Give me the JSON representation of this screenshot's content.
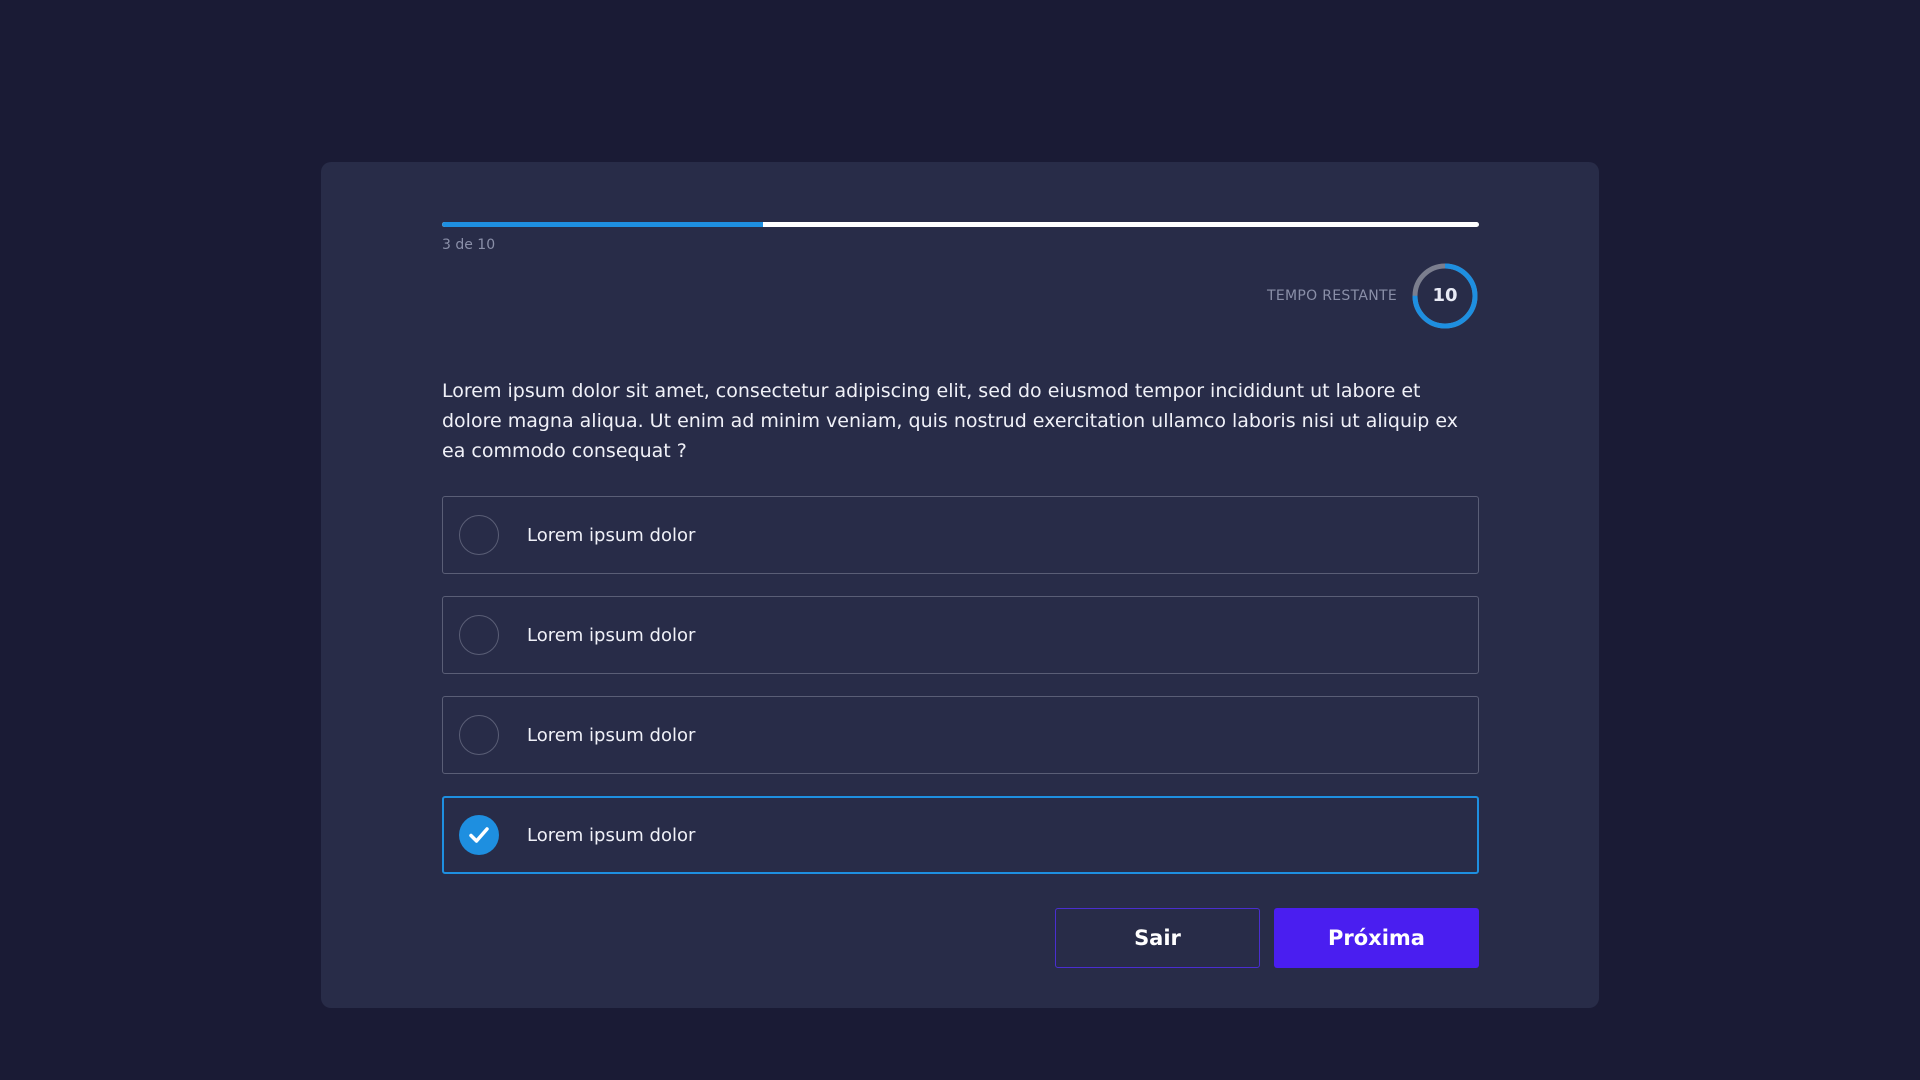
{
  "progress": {
    "current": 3,
    "total": 10,
    "label": "3 de 10",
    "fraction": 0.31
  },
  "timer": {
    "label": "TEMPO RESTANTE",
    "value": "10",
    "fraction": 0.75
  },
  "question": {
    "text": "Lorem ipsum dolor sit amet, consectetur adipiscing elit, sed do eiusmod tempor incididunt ut labore et dolore magna aliqua. Ut enim ad minim veniam, quis nostrud exercitation ullamco laboris nisi ut aliquip ex ea commodo consequat ?"
  },
  "options": [
    {
      "label": "Lorem ipsum dolor",
      "selected": false
    },
    {
      "label": "Lorem ipsum dolor",
      "selected": false
    },
    {
      "label": "Lorem ipsum dolor",
      "selected": false
    },
    {
      "label": "Lorem ipsum dolor",
      "selected": true
    }
  ],
  "actions": {
    "exit_label": "Sair",
    "next_label": "Próxima"
  },
  "colors": {
    "accent": "#1e8fe0",
    "primary_button": "#4a1ef0",
    "background": "#1a1b35",
    "card": "#282c48"
  },
  "icons": {
    "selected": "check-icon",
    "unselected": "radio-empty-icon"
  }
}
